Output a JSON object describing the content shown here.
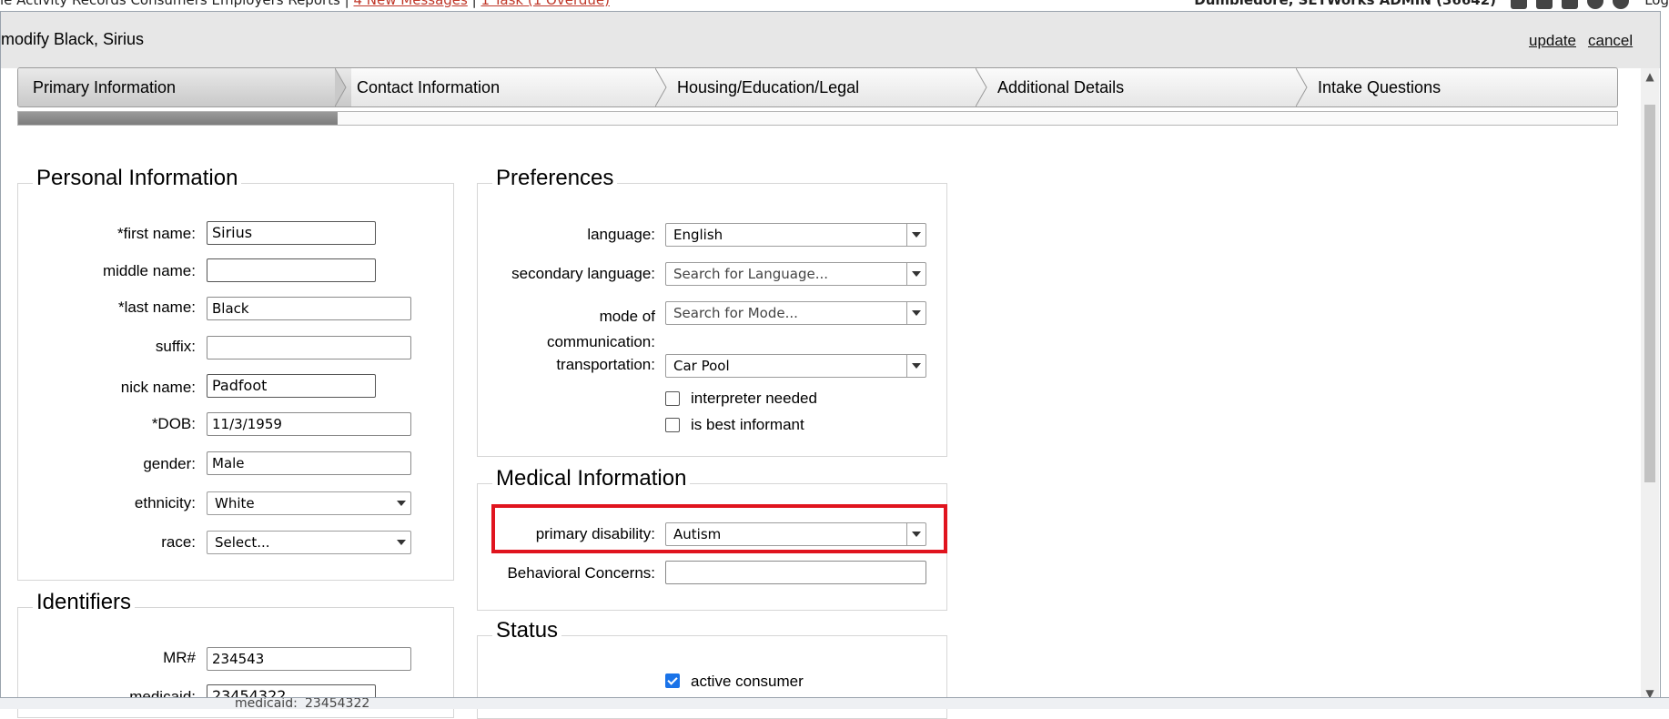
{
  "top_bar": {
    "nav_text": "le  Activity Records  Consumers  Employers  Reports",
    "messages": "4 New Messages",
    "tasks": "1 Task (1 Overdue)",
    "user": "Dumbledore, SETWorks ADMIN  (36642)",
    "logout": "Log"
  },
  "dialog": {
    "title": "modify Black, Sirius",
    "update_label": "update",
    "cancel_label": "cancel"
  },
  "wizard": {
    "steps": [
      "Primary Information",
      "Contact Information",
      "Housing/Education/Legal",
      "Additional Details",
      "Intake Questions"
    ],
    "active_index": 0,
    "progress_fraction": 0.2
  },
  "personal": {
    "legend": "Personal Information",
    "first_name_label": "*first name:",
    "first_name": "Sirius",
    "middle_name_label": "middle name:",
    "middle_name": "",
    "last_name_label": "*last name:",
    "last_name": "Black",
    "suffix_label": "suffix:",
    "suffix": "",
    "nick_name_label": "nick name:",
    "nick_name": "Padfoot",
    "dob_label": "*DOB:",
    "dob": "11/3/1959",
    "gender_label": "gender:",
    "gender": "Male",
    "ethnicity_label": "ethnicity:",
    "ethnicity": "White",
    "race_label": "race:",
    "race": "Select..."
  },
  "identifiers": {
    "legend": "Identifiers",
    "mr_label": "MR#",
    "mr": "234543",
    "medicaid_label": "medicaid:",
    "medicaid": "23454322"
  },
  "preferences": {
    "legend": "Preferences",
    "language_label": "language:",
    "language": "English",
    "secondary_language_label": "secondary language:",
    "secondary_language_placeholder": "Search for Language...",
    "mode_label_line1": "mode of",
    "mode_label_line2": "communication:",
    "mode_placeholder": "Search for Mode...",
    "transportation_label": "transportation:",
    "transportation": "Car Pool",
    "interpreter_needed_label": "interpreter needed",
    "interpreter_needed": false,
    "best_informant_label": "is best informant",
    "best_informant": false
  },
  "medical": {
    "legend": "Medical Information",
    "primary_disability_label": "primary disability:",
    "primary_disability": "Autism",
    "behavioral_concerns_label": "Behavioral Concerns:",
    "behavioral_concerns": ""
  },
  "status": {
    "legend": "Status",
    "active_consumer_label": "active consumer",
    "active_consumer": true
  },
  "bottom_strip": {
    "medicaid_label": "medicaid:",
    "medicaid_value": "23454322"
  },
  "colors": {
    "highlight": "#e0141e",
    "checkbox_on": "#1a73e8"
  }
}
